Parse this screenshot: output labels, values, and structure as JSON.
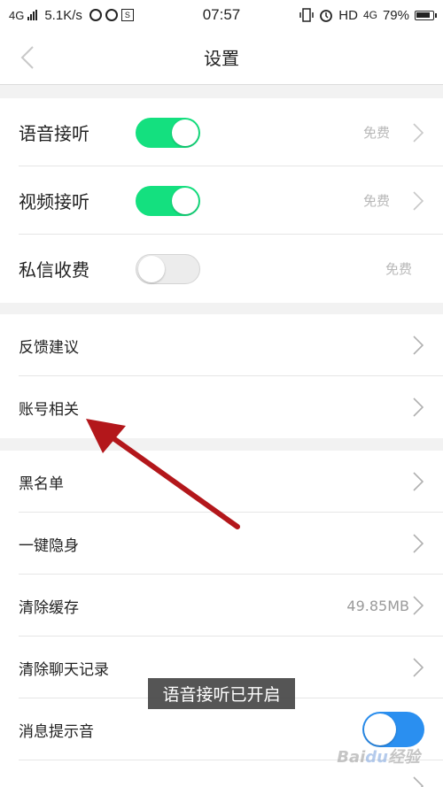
{
  "status_bar": {
    "network": "4G",
    "speed": "5.1K/s",
    "time": "07:57",
    "hd": "HD",
    "net2": "4G",
    "battery": "79%"
  },
  "header": {
    "title": "设置"
  },
  "toggle_rows": [
    {
      "label": "语音接听",
      "value": "免费",
      "enabled": true
    },
    {
      "label": "视频接听",
      "value": "免费",
      "enabled": true
    },
    {
      "label": "私信收费",
      "value": "免费",
      "enabled": false
    }
  ],
  "section2": [
    {
      "label": "反馈建议"
    },
    {
      "label": "账号相关"
    }
  ],
  "section3": [
    {
      "label": "黑名单"
    },
    {
      "label": "一键隐身"
    },
    {
      "label": "清除缓存",
      "value": "49.85MB"
    },
    {
      "label": "清除聊天记录"
    },
    {
      "label": "消息提示音",
      "enabled": true
    }
  ],
  "toast": {
    "text": "语音接听已开启"
  },
  "watermark": "Baidu经验",
  "colors": {
    "toggle_on": "#14e07f",
    "toggle_blue": "#2a8ff0",
    "annotation_arrow": "#b3171b"
  }
}
